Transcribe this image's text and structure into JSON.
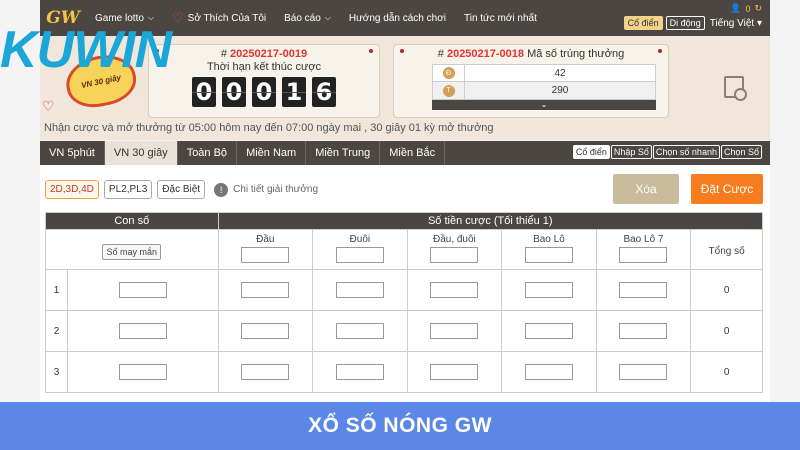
{
  "brand": {
    "kuwin": "KUWIN",
    "gw": "GW",
    "badge": "VN 30 giây"
  },
  "nav": {
    "items": [
      {
        "label": "Game lotto",
        "chevron": true
      },
      {
        "label": "Sở Thích Của Tôi",
        "icon": "heart-icon"
      },
      {
        "label": "Báo cáo",
        "chevron": true
      },
      {
        "label": "Hướng dẫn cách chơi"
      },
      {
        "label": "Tin tức mới nhất"
      }
    ],
    "balance": "0",
    "mode_classic": "Cổ điển",
    "mode_mobile": "Di động",
    "language": "Tiếng Việt"
  },
  "timer": {
    "hash": "#",
    "round": "20250217-0019",
    "label": "Thời hạn kết thúc cược",
    "digits": [
      "0",
      "0",
      "0",
      "1",
      "6"
    ]
  },
  "result": {
    "hash": "#",
    "round": "20250217-0018",
    "label": "Mã số trúng thưởng",
    "rows": [
      {
        "ball": "Đ",
        "value": "42"
      },
      {
        "ball": "T",
        "value": "290"
      }
    ],
    "toggle": "⌄"
  },
  "notice": "Nhận cược và mở thưởng từ 05:00 hôm nay đến 07:00 ngày mai ,  30 giây 01 kỳ mở thưởng",
  "tabs": [
    "VN 5phút",
    "VN 30 giây",
    "Toàn Bộ",
    "Miền Nam",
    "Miền Trung",
    "Miền Bắc"
  ],
  "active_tab": 1,
  "mode_tabs": [
    "Cổ điển",
    "Nhập Số",
    "Chọn số nhanh",
    "Chọn Số"
  ],
  "chips": [
    "2D,3D,4D",
    "PL2,PL3",
    "Đặc Biệt"
  ],
  "detail_link": "Chi tiết giải thưởng",
  "buttons": {
    "clear": "Xóa",
    "bet": "Đặt Cược"
  },
  "table": {
    "col_number": "Con số",
    "col_amount": "Số tiền cược (Tối thiểu 1)",
    "lucky_btn": "Số may mắn",
    "sub_headers": [
      "Đầu",
      "Đuôi",
      "Đầu, đuôi",
      "Bao Lô",
      "Bao Lô 7"
    ],
    "col_total": "Tổng số",
    "rows": [
      {
        "index": "1",
        "total": "0"
      },
      {
        "index": "2",
        "total": "0"
      },
      {
        "index": "3",
        "total": "0"
      }
    ]
  },
  "banner": "XỔ SỐ NÓNG GW"
}
